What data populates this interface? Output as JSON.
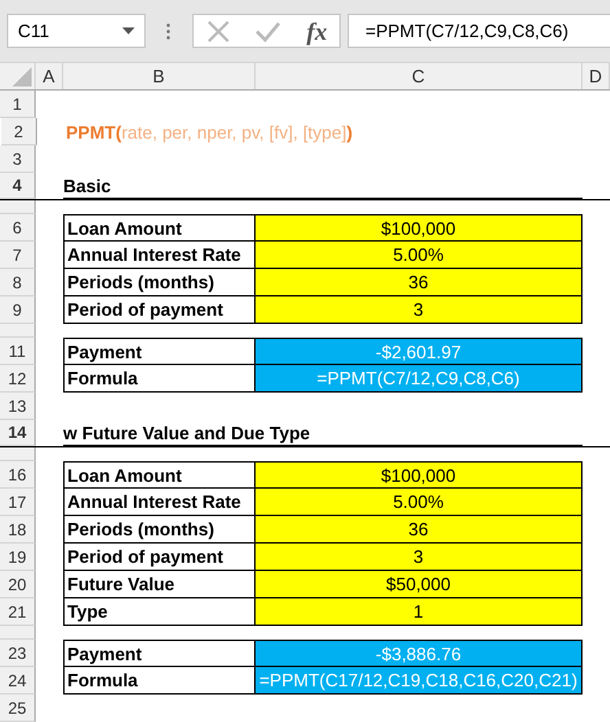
{
  "formula_bar": {
    "name_box": "C11",
    "function_label": "fx",
    "formula": "=PPMT(C7/12,C9,C8,C6)"
  },
  "column_headers": [
    "A",
    "B",
    "C",
    "D"
  ],
  "rows": [
    {
      "kind": "blank",
      "number": "1"
    },
    {
      "kind": "title",
      "number": "2",
      "text": "**PPMT(**rate, per, nper, pv, [fv], [type]**)**"
    },
    {
      "kind": "blank",
      "number": "3"
    },
    {
      "kind": "heading",
      "number": "4",
      "text": "Basic"
    },
    {
      "kind": "spacer"
    },
    {
      "kind": "input",
      "number": "6",
      "label": "Loan Amount",
      "value": "$100,000"
    },
    {
      "kind": "input",
      "number": "7",
      "label": "Annual Interest Rate",
      "value": "5.00%"
    },
    {
      "kind": "input",
      "number": "8",
      "label": "Periods (months)",
      "value": "36"
    },
    {
      "kind": "input",
      "number": "9",
      "label": "Period of payment",
      "value": "3"
    },
    {
      "kind": "spacer"
    },
    {
      "kind": "result",
      "number": "11",
      "label": "Payment",
      "value": "-$2,601.97"
    },
    {
      "kind": "result",
      "number": "12",
      "label": "Formula",
      "value": "=PPMT(C7/12,C9,C8,C6)"
    },
    {
      "kind": "blank",
      "number": "13"
    },
    {
      "kind": "heading",
      "number": "14",
      "text": "w Future Value and Due Type"
    },
    {
      "kind": "spacer"
    },
    {
      "kind": "input",
      "number": "16",
      "label": "Loan Amount",
      "value": "$100,000"
    },
    {
      "kind": "input",
      "number": "17",
      "label": "Annual Interest Rate",
      "value": "5.00%"
    },
    {
      "kind": "input",
      "number": "18",
      "label": "Periods (months)",
      "value": "36"
    },
    {
      "kind": "input",
      "number": "19",
      "label": "Period of payment",
      "value": "3"
    },
    {
      "kind": "input",
      "number": "20",
      "label": "Future Value",
      "value": "$50,000"
    },
    {
      "kind": "input",
      "number": "21",
      "label": "Type",
      "value": "1"
    },
    {
      "kind": "spacer"
    },
    {
      "kind": "result",
      "number": "23",
      "label": "Payment",
      "value": "-$3,886.76"
    },
    {
      "kind": "result",
      "number": "24",
      "label": "Formula",
      "value": "=PPMT(C17/12,C19,C18,C16,C20,C21)"
    },
    {
      "kind": "blank",
      "number": "25"
    }
  ]
}
